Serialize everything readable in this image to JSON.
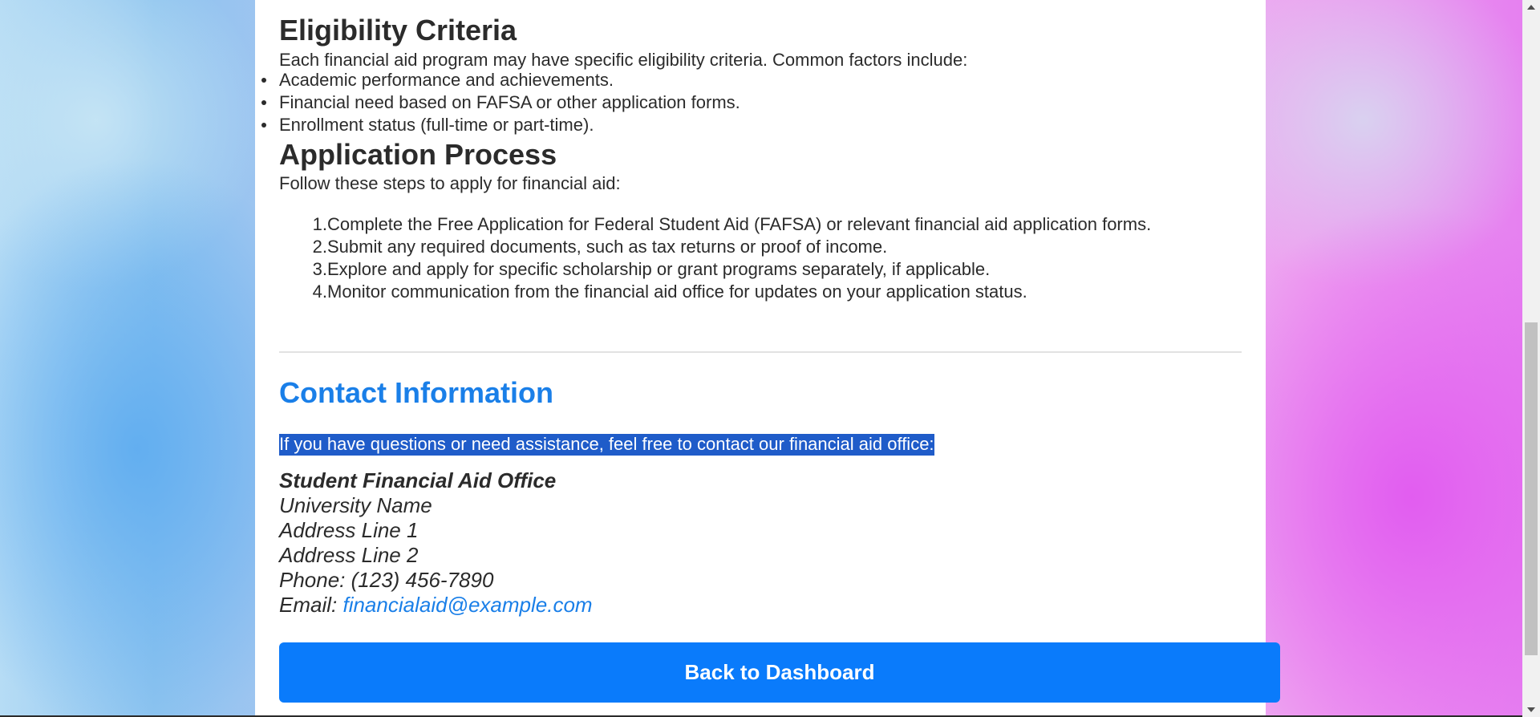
{
  "eligibility": {
    "title": "Eligibility Criteria",
    "intro": "Each financial aid program may have specific eligibility criteria. Common factors include:",
    "items": [
      "Academic performance and achievements.",
      "Financial need based on FAFSA or other application forms.",
      "Enrollment status (full-time or part-time)."
    ]
  },
  "application": {
    "title": "Application Process",
    "intro": "Follow these steps to apply for financial aid:",
    "steps": [
      {
        "num": "1.",
        "text": "Complete the Free Application for Federal Student Aid (FAFSA) or relevant financial aid application forms."
      },
      {
        "num": "2.",
        "text": "Submit any required documents, such as tax returns or proof of income."
      },
      {
        "num": "3.",
        "text": "Explore and apply for specific scholarship or grant programs separately, if applicable."
      },
      {
        "num": "4.",
        "text": "Monitor communication from the financial aid office for updates on your application status."
      }
    ]
  },
  "contact": {
    "title": "Contact Information",
    "intro": "If you have questions or need assistance, feel free to contact our financial aid office:",
    "office": "Student Financial Aid Office",
    "university": "University Name",
    "address1": "Address Line 1",
    "address2": "Address Line 2",
    "phone": "Phone: (123) 456-7890",
    "email_label": "Email: ",
    "email": "financialaid@example.com"
  },
  "actions": {
    "back_label": "Back to Dashboard"
  },
  "colors": {
    "accent": "#1a7fe8",
    "button": "#0a7bfb",
    "selection": "#1f5cc9"
  }
}
